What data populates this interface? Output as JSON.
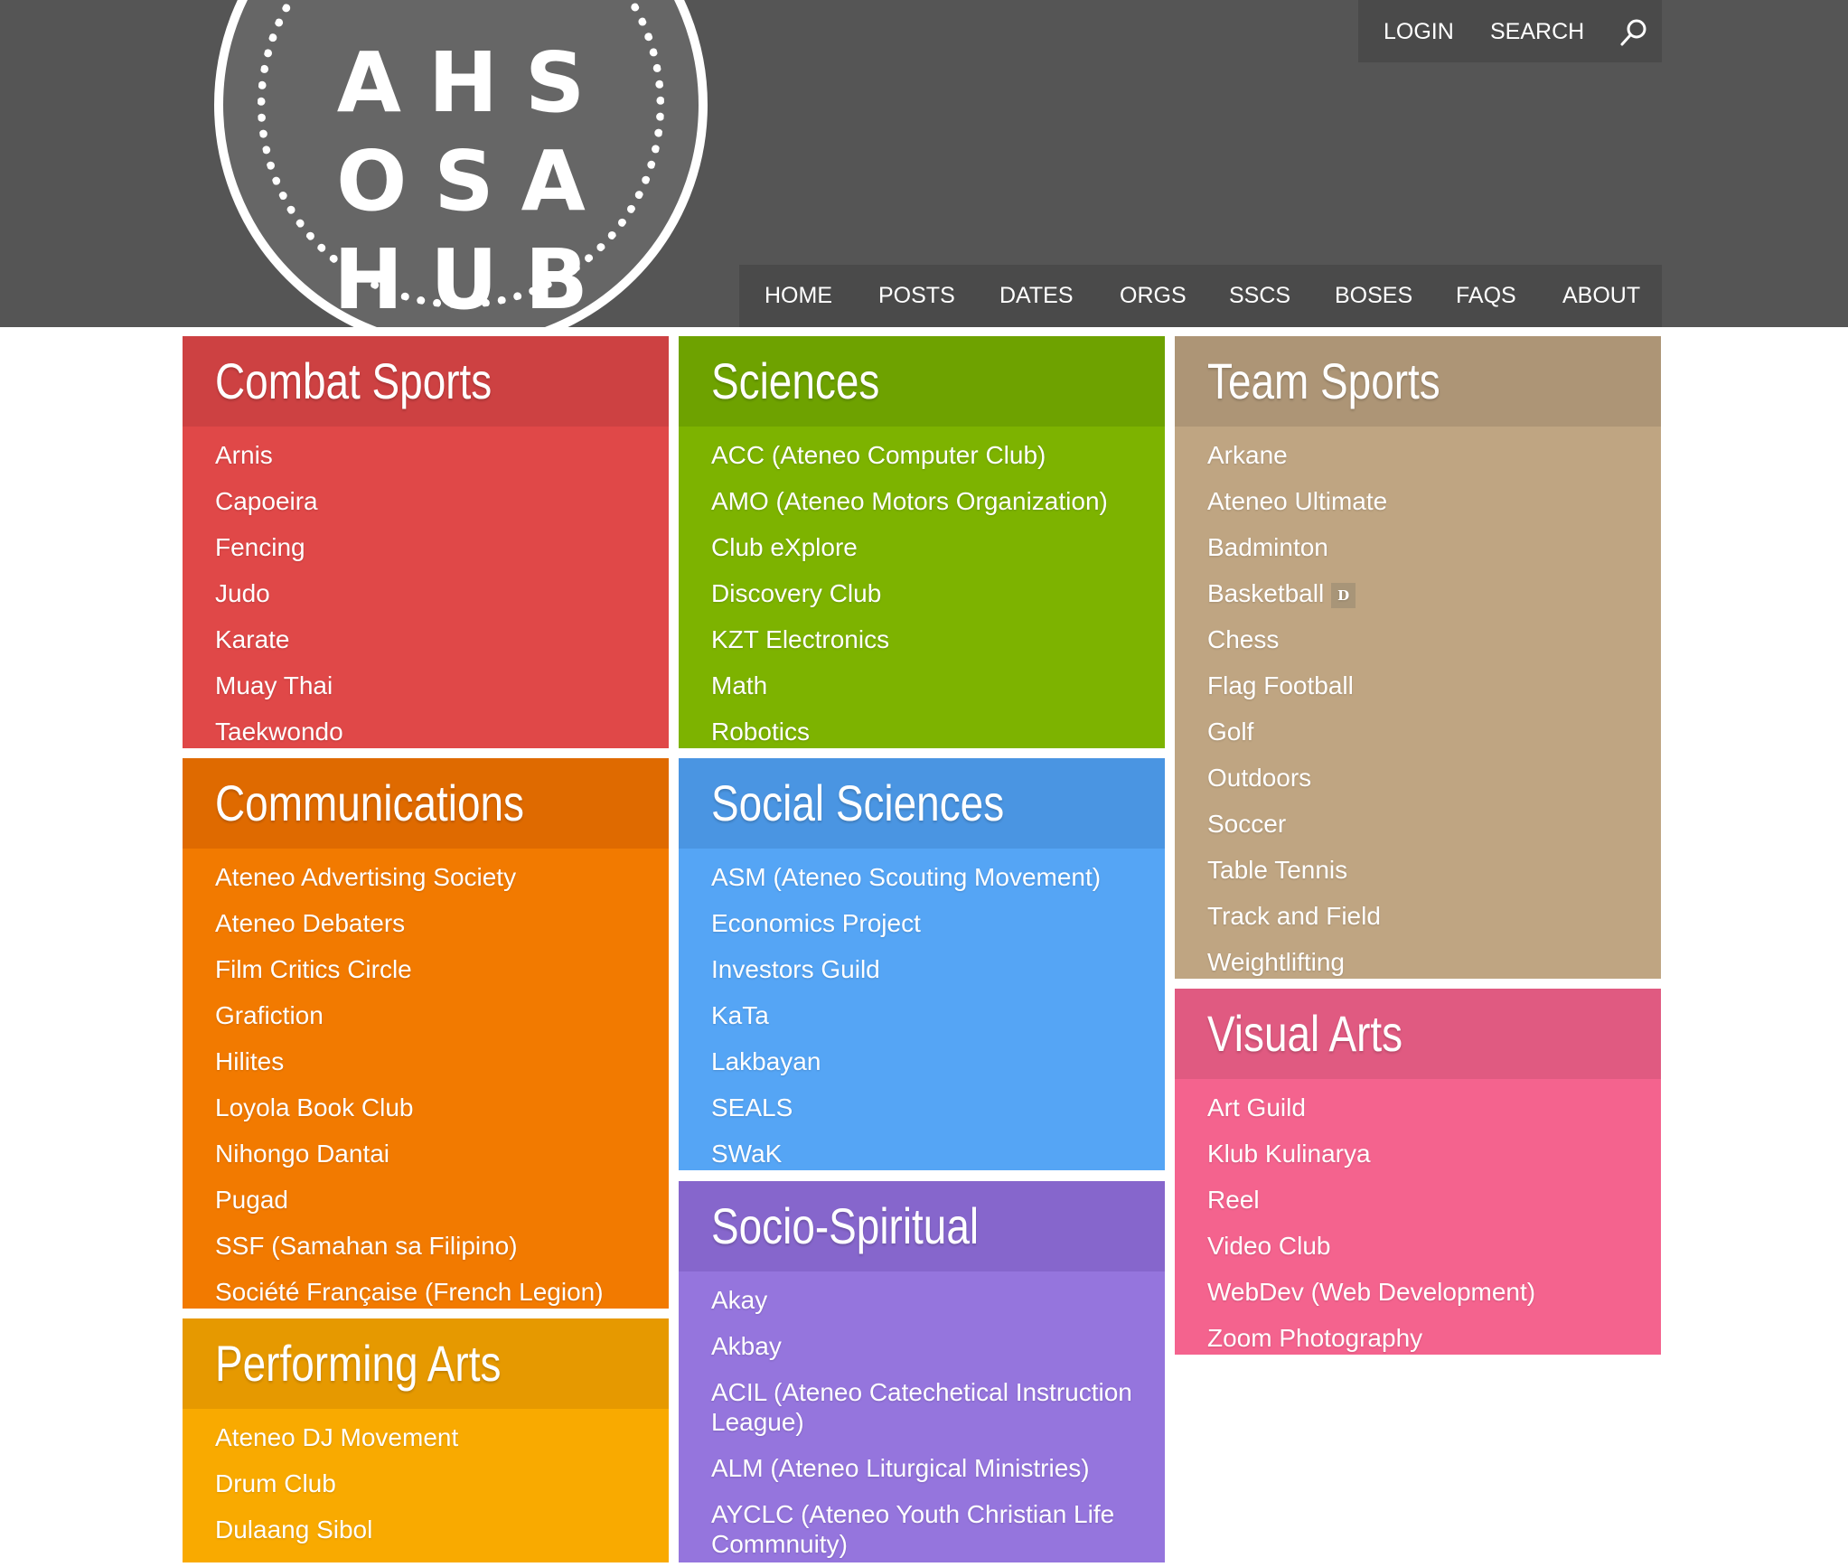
{
  "logo": {
    "lines": [
      "AHS",
      "OSA",
      "HUB"
    ]
  },
  "utility": {
    "login": "LOGIN",
    "search": "SEARCH"
  },
  "nav": [
    "HOME",
    "POSTS",
    "DATES",
    "ORGS",
    "SSCS",
    "BOSES",
    "FAQS",
    "ABOUT"
  ],
  "colors": {
    "header_bg": "#555555",
    "combat_sports": "#e04848",
    "communications": "#f27a00",
    "performing_arts": "#f9aa00",
    "sciences": "#7db300",
    "social_sciences": "#55a5f5",
    "socio_spiritual": "#9575dd",
    "team_sports": "#bfa582",
    "visual_arts": "#f4638e"
  },
  "categories": {
    "combat_sports": {
      "title": "Combat Sports",
      "items": [
        "Arnis",
        "Capoeira",
        "Fencing",
        "Judo",
        "Karate",
        "Muay Thai",
        "Taekwondo"
      ]
    },
    "communications": {
      "title": "Communications",
      "items": [
        "Ateneo Advertising Society",
        "Ateneo Debaters",
        "Film Critics Circle",
        "Grafiction",
        "Hilites",
        "Loyola Book Club",
        "Nihongo Dantai",
        "Pugad",
        "SSF (Samahan sa Filipino)",
        "Société Française (French Legion)"
      ]
    },
    "performing_arts": {
      "title": "Performing Arts",
      "items": [
        "Ateneo DJ Movement",
        "Drum Club",
        "Dulaang Sibol"
      ]
    },
    "sciences": {
      "title": "Sciences",
      "items": [
        "ACC (Ateneo Computer Club)",
        "AMO (Ateneo Motors Organization)",
        "Club eXplore",
        "Discovery Club",
        "KZT Electronics",
        "Math",
        "Robotics"
      ]
    },
    "social_sciences": {
      "title": "Social Sciences",
      "items": [
        "ASM (Ateneo Scouting Movement)",
        "Economics Project",
        "Investors Guild",
        "KaTa",
        "Lakbayan",
        "SEALS",
        "SWaK"
      ]
    },
    "socio_spiritual": {
      "title": "Socio-Spiritual",
      "items": [
        "Akay",
        "Akbay",
        "ACIL (Ateneo Catechetical Instruction League)",
        "ALM (Ateneo Liturgical Ministries)",
        "AYCLC (Ateneo Youth Christian Life Commnuity)"
      ]
    },
    "team_sports": {
      "title": "Team Sports",
      "items": [
        "Arkane",
        "Ateneo Ultimate",
        "Badminton",
        "Basketball",
        "Chess",
        "Flag Football",
        "Golf",
        "Outdoors",
        "Soccer",
        "Table Tennis",
        "Track and Field",
        "Weightlifting"
      ],
      "badge": "D"
    },
    "visual_arts": {
      "title": "Visual Arts",
      "items": [
        "Art Guild",
        "Klub Kulinarya",
        "Reel",
        "Video Club",
        "WebDev (Web Development)",
        "Zoom Photography"
      ]
    }
  }
}
